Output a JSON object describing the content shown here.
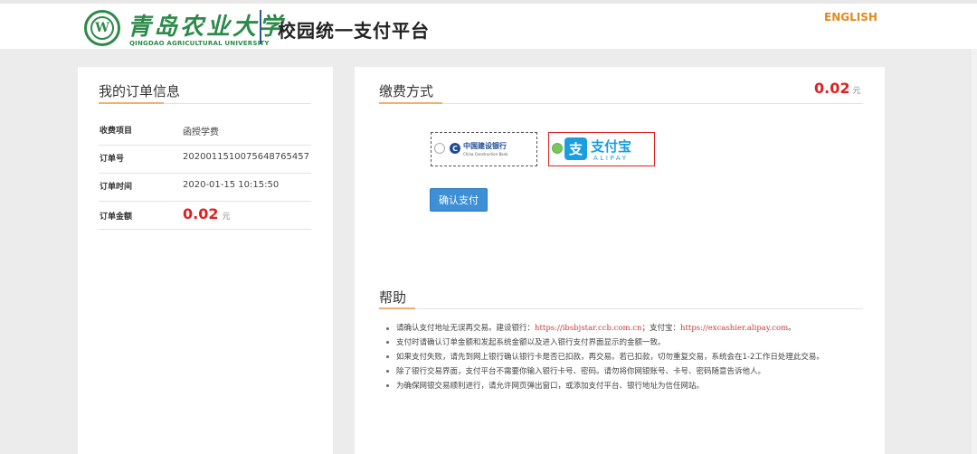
{
  "header": {
    "seal_letter": "W",
    "university_cn": "青岛农业大学",
    "university_en": "QINGDAO AGRICULTURAL UNIVERSITY",
    "platform_title": "校园统一支付平台",
    "language_link": "ENGLISH"
  },
  "order_info": {
    "title": "我的订单信息",
    "rows": [
      {
        "label": "收费项目",
        "value": "函授学费"
      },
      {
        "label": "订单号",
        "value": "202001151007564876545​7"
      },
      {
        "label": "订单时间",
        "value": "2020-01-15 10:15:50"
      },
      {
        "label": "订单金额",
        "value": "0.02",
        "unit": "元"
      }
    ]
  },
  "payment": {
    "title": "缴费方式",
    "total_amount": "0.02",
    "total_unit": "元",
    "options": [
      {
        "id": "ccb",
        "mark": "C",
        "name": "中国建设银行",
        "name_en": "China Construction Bank",
        "selected": false
      },
      {
        "id": "alipay",
        "mark": "支",
        "name": "支付宝",
        "name_en": "ALIPAY",
        "selected": true
      }
    ],
    "confirm_label": "确认支付"
  },
  "help": {
    "title": "帮助",
    "item1_before": "请确认支付地址无误再交易。建设银行：",
    "item1_link1": "https://ibsbjstar.ccb.com.cn",
    "item1_between": "；支付宝：",
    "item1_link2": "https://excashier.alipay.com",
    "item1_after": "。",
    "items": [
      "支付时请确认订单金额和发起系统金额以及进入银行支付界面显示的金额一致。",
      "如果支付失败，请先到网上银行确认银行卡是否已扣款，再交易。若已扣款，切勿重复交易，系统会在1-2工作日处理此交易。",
      "除了银行交易界面，支付平台不需要你输入银行卡号、密码。请勿将你网银账号、卡号、密码随意告诉他人。",
      "为确保网银交易顺利进行，请允许网页弹出窗口，或添加支付平台、银行地址为信任网站。"
    ]
  },
  "colors": {
    "brand_green": "#2d8a4a",
    "amount_red": "#e02020",
    "accent_orange": "#e08a1e",
    "button_blue": "#3d8fd6",
    "alipay_blue": "#1a9ee0",
    "ccb_blue": "#1c4a94"
  }
}
